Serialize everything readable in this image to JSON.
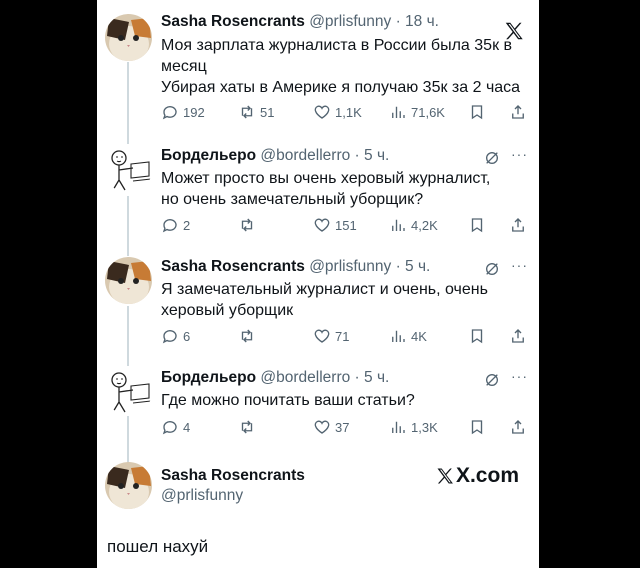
{
  "tweets": [
    {
      "name": "Sasha Rosencrants",
      "handle": "@prlisfunny",
      "time": "18 ч.",
      "text_lines": [
        "Моя зарплата журналиста в России была 35к в",
        "месяц",
        "Убирая хаты в Америке я получаю 35к за 2 часа"
      ],
      "replies": "192",
      "retweets": "51",
      "likes": "1,1K",
      "views": "71,6K",
      "avatar": "cat-avatar"
    },
    {
      "name": "Бордельеро",
      "handle": "@bordellerro",
      "time": "5 ч.",
      "text_lines": [
        "Может просто вы очень херовый журналист,",
        "но очень замечательный уборщик?"
      ],
      "replies": "2",
      "retweets": "",
      "likes": "151",
      "views": "4,2K",
      "avatar": "sketch-avatar"
    },
    {
      "name": "Sasha Rosencrants",
      "handle": "@prlisfunny",
      "time": "5 ч.",
      "text_lines": [
        "Я замечательный журналист и очень, очень",
        "херовый уборщик"
      ],
      "replies": "6",
      "retweets": "",
      "likes": "71",
      "views": "4K",
      "avatar": "cat-avatar"
    },
    {
      "name": "Бордельеро",
      "handle": "@bordellerro",
      "time": "5 ч.",
      "text_lines": [
        "Где можно почитать ваши статьи?"
      ],
      "replies": "4",
      "retweets": "",
      "likes": "37",
      "views": "1,3K",
      "avatar": "sketch-avatar"
    }
  ],
  "final": {
    "name": "Sasha Rosencrants",
    "handle": "@prlisfunny",
    "brand": "X.com",
    "text": "пошел нахуй"
  },
  "colors": {
    "text": "#0f1419",
    "muted": "#536471",
    "thread": "#cfd9de",
    "frame": "#000000"
  }
}
